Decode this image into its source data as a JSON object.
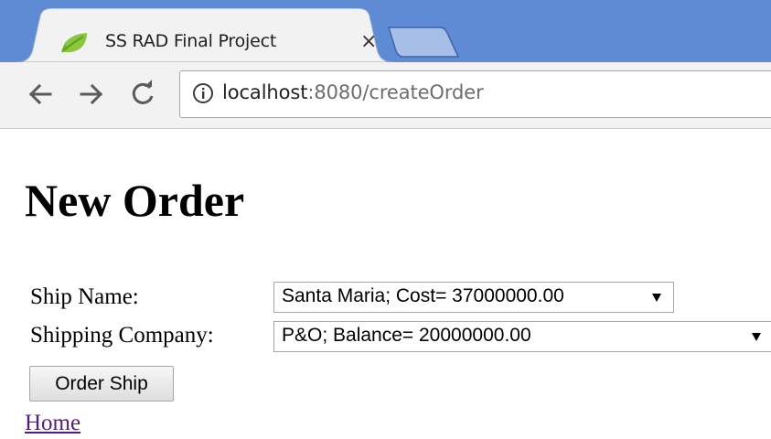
{
  "browser": {
    "tab": {
      "title": "SS RAD Final Project",
      "close_glyph": "×",
      "favicon": "spring-leaf-icon"
    },
    "nav": {
      "back_icon": "back-arrow-icon",
      "forward_icon": "forward-arrow-icon",
      "reload_icon": "reload-icon"
    },
    "address": {
      "info_icon": "info-icon",
      "host": "localhost",
      "rest": ":8080/createOrder"
    },
    "colors": {
      "tabstrip": "#5f8bd4",
      "toolbar": "#f2f2f2"
    }
  },
  "page": {
    "title": "New Order",
    "form": {
      "ship_label": "Ship Name:",
      "ship_value": "Santa Maria; Cost= 37000000.00",
      "company_label": "Shipping Company:",
      "company_value": "P&O; Balance= 20000000.00",
      "submit_label": "Order Ship"
    },
    "home_link": "Home",
    "colors": {
      "visited_link": "#551a8b"
    }
  }
}
